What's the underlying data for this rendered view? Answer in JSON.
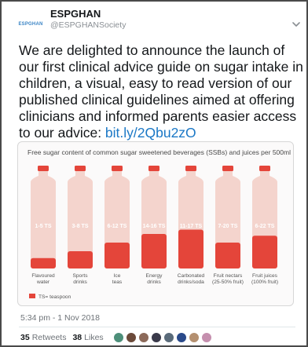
{
  "author": {
    "avatar_text": "ESPGHAN",
    "name": "ESPGHAN",
    "handle": "@ESPGHANSociety"
  },
  "tweet": {
    "text": "We are delighted to announce the launch of our first clinical advice guide on sugar intake in children, a visual, easy to read version of our published clinical guidelines aimed at offering clinicians and informed parents easier access to our advice: ",
    "link": "bit.ly/2Qbu2zO"
  },
  "infographic": {
    "title": "Free sugar content of common sugar sweetened beverages (SSBs) and juices per 500ml",
    "legend": "TS= teaspoon",
    "colors": {
      "bottle": "#f4d4cd",
      "fill": "#e4453a",
      "cap": "#e4453a"
    },
    "bottles": [
      {
        "label": "1-5 TS",
        "category": [
          "Flavoured",
          "water"
        ],
        "fill_fraction": 0.12
      },
      {
        "label": "3-8 TS",
        "category": [
          "Sports",
          "drinks"
        ],
        "fill_fraction": 0.2
      },
      {
        "label": "6-12 TS",
        "category": [
          "Ice",
          "teas"
        ],
        "fill_fraction": 0.3
      },
      {
        "label": "14-16 TS",
        "category": [
          "Energy",
          "drinks"
        ],
        "fill_fraction": 0.4
      },
      {
        "label": "11-17 TS",
        "category": [
          "Carbonated",
          "drinks/soda"
        ],
        "fill_fraction": 0.45
      },
      {
        "label": "7-20 TS",
        "category": [
          "Fruit nectars",
          "(25-50% fruit)"
        ],
        "fill_fraction": 0.3
      },
      {
        "label": "6-22 TS",
        "category": [
          "Fruit juices",
          "(100% fruit)"
        ],
        "fill_fraction": 0.38
      }
    ]
  },
  "meta": {
    "timestamp": "5:34 pm - 1 Nov 2018",
    "retweets_count": "35",
    "retweets_label": "Retweets",
    "likes_count": "38",
    "likes_label": "Likes",
    "liker_colors": [
      "#4d8f7a",
      "#6b4a3a",
      "#8c6a5a",
      "#3a3a4a",
      "#5a6b7a",
      "#2a4a8a",
      "#b49070",
      "#c58fae"
    ]
  }
}
